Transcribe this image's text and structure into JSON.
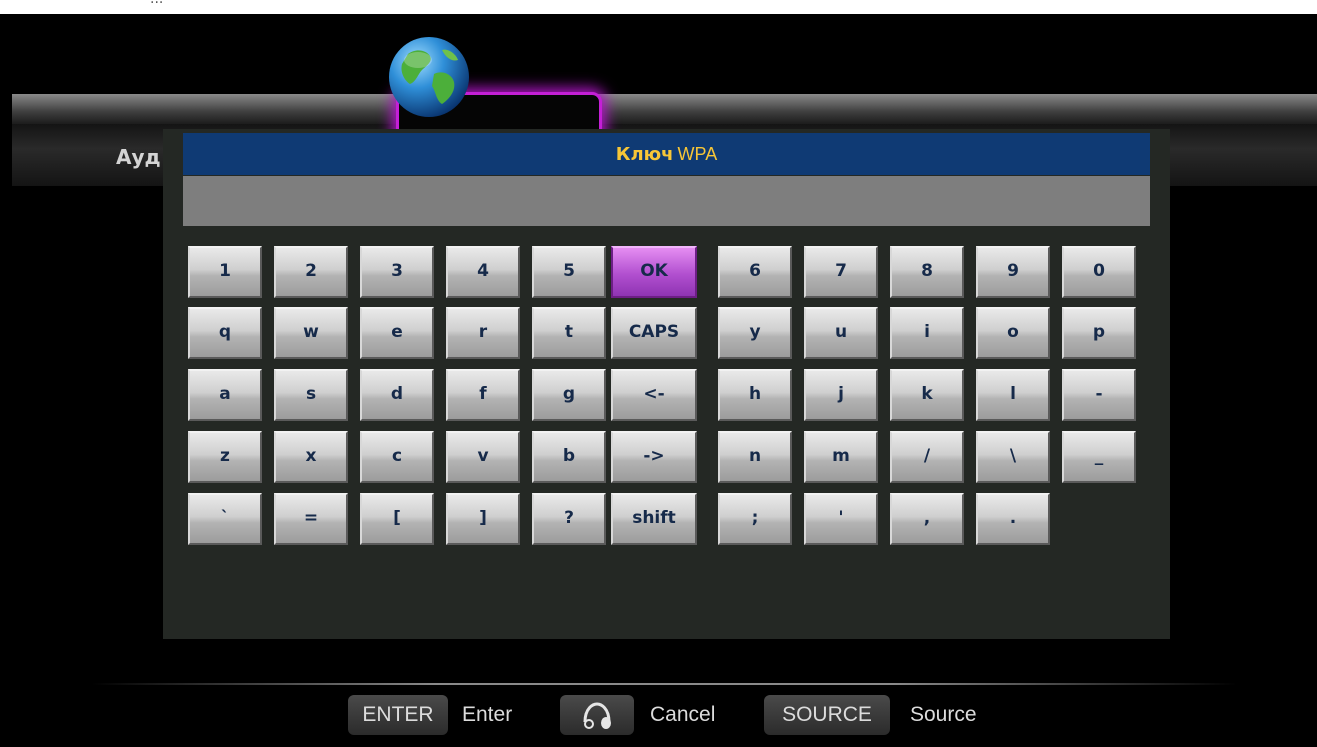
{
  "background": {
    "top_cut_text": "...",
    "menu_label": "Ауд"
  },
  "dialog": {
    "title_part1": "Ключ",
    "title_part2": "WPA",
    "input_value": ""
  },
  "keyboard": {
    "rows": [
      [
        "1",
        "2",
        "3",
        "4",
        "5",
        "OK",
        "6",
        "7",
        "8",
        "9",
        "0"
      ],
      [
        "q",
        "w",
        "e",
        "r",
        "t",
        "CAPS",
        "y",
        "u",
        "i",
        "o",
        "p"
      ],
      [
        "a",
        "s",
        "d",
        "f",
        "g",
        "<-",
        "h",
        "j",
        "k",
        "l",
        "-"
      ],
      [
        "z",
        "x",
        "c",
        "v",
        "b",
        "->",
        "n",
        "m",
        "/",
        "\\",
        "_"
      ],
      [
        "`",
        "=",
        "[",
        "]",
        "?",
        "shift",
        ";",
        "'",
        ",",
        "."
      ]
    ],
    "active_key": "OK"
  },
  "footer": {
    "enter_button": "ENTER",
    "enter_hint": "Enter",
    "cancel_icon": "headphones-return-icon",
    "cancel_hint": "Cancel",
    "source_button": "SOURCE",
    "source_hint": "Source"
  },
  "colors": {
    "title_bar": "#0f3a74",
    "title_text": "#f7c637",
    "active_key": "#b14fcf",
    "tab_glow": "#c41fd6"
  }
}
